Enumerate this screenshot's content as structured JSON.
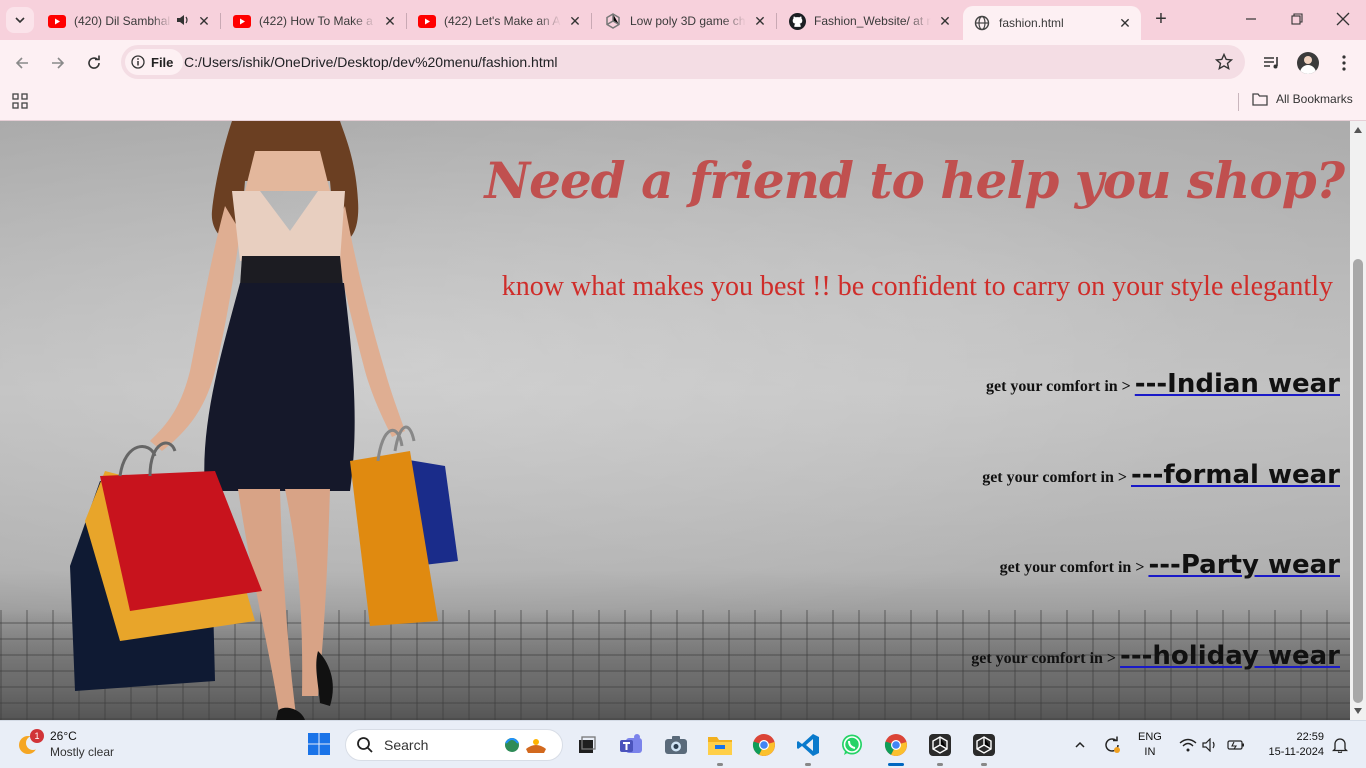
{
  "browser": {
    "tabs": [
      {
        "title": "(420) Dil Sambhal",
        "favicon": "youtube-icon",
        "audio": true
      },
      {
        "title": "(422) How To Make a",
        "favicon": "youtube-icon"
      },
      {
        "title": "(422) Let's Make an A",
        "favicon": "youtube-icon"
      },
      {
        "title": "Low poly 3D game ch",
        "favicon": "unity-icon"
      },
      {
        "title": "Fashion_Website/ at n",
        "favicon": "github-icon"
      },
      {
        "title": "fashion.html",
        "favicon": "globe-icon",
        "active": true
      }
    ],
    "omnibox": {
      "chip_label": "File",
      "url": "C:/Users/ishik/OneDrive/Desktop/dev%20menu/fashion.html"
    },
    "bookmarks": {
      "all_label": "All Bookmarks"
    },
    "colors": {
      "tabstrip": "#f7d1dc",
      "toolbar": "#fdf0f3"
    }
  },
  "page": {
    "headline": "Need a friend to help you shop?",
    "tagline": "know what makes you best !! be confident to carry on your style elegantly",
    "links": [
      {
        "prefix": "get your comfort in >",
        "label": "---Indian wear"
      },
      {
        "prefix": "get your comfort in >",
        "label": "---formal wear"
      },
      {
        "prefix": "get your comfort in >",
        "label": "---Party wear"
      },
      {
        "prefix": "get your comfort in >",
        "label": "---holiday wear"
      }
    ],
    "colors": {
      "headline": "#c0504f",
      "tagline": "#cf2d2a",
      "link_underline": "#1a1ac8"
    }
  },
  "taskbar": {
    "weather": {
      "temp": "26°C",
      "condition": "Mostly clear",
      "badge": "1"
    },
    "search_placeholder": "Search",
    "language": {
      "line1": "ENG",
      "line2": "IN"
    },
    "clock": {
      "time": "22:59",
      "date": "15-11-2024"
    }
  }
}
